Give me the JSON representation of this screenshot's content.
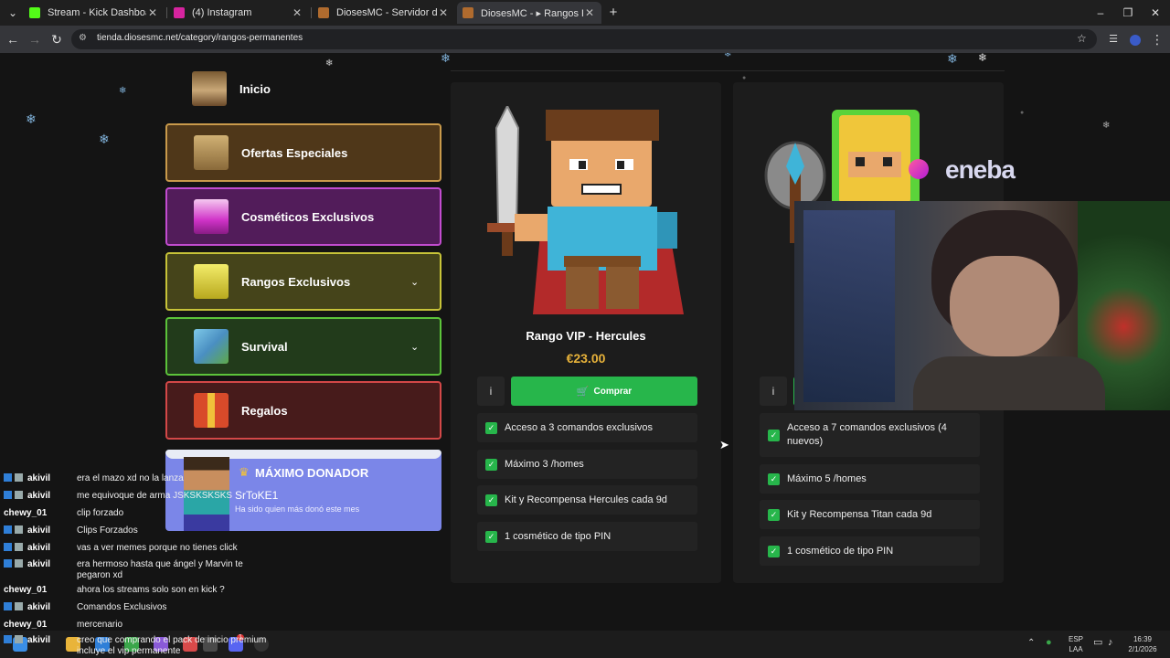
{
  "browser": {
    "tabs": [
      {
        "title": "Stream - Kick Dashboard",
        "color": "#53fc18"
      },
      {
        "title": "(4) Instagram",
        "color": "#d6249f"
      },
      {
        "title": "DiosesMC - Servidor de Minecra",
        "color": "#b06b2e"
      },
      {
        "title": "DiosesMC - ▸ Rangos Permanen",
        "color": "#b06b2e"
      }
    ],
    "url": "tienda.diosesmc.net/category/rangos-permanentes"
  },
  "sidebar": {
    "home_label": "Inicio",
    "items": [
      {
        "label": "Ofertas Especiales",
        "border": "#c99a4b",
        "bg": "#5a3e1f",
        "icon": "treasure-chest-icon"
      },
      {
        "label": "Cosméticos Exclusivos",
        "border": "#c24ccf",
        "bg": "#5a1f63",
        "icon": "cosmetic-box-icon"
      },
      {
        "label": "Rangos Exclusivos",
        "border": "#c7c338",
        "bg": "#4a4a1a",
        "icon": "golden-skull-icon",
        "chevron": "⌄"
      },
      {
        "label": "Survival",
        "border": "#5cc33a",
        "bg": "#243f1e",
        "icon": "earth-block-icon",
        "chevron": "⌄"
      },
      {
        "label": "Regalos",
        "border": "#d34848",
        "bg": "#4e1e1e",
        "icon": "gift-icon"
      }
    ],
    "donor": {
      "title": "MÁXIMO DONADOR",
      "name": "SrToKE1",
      "desc": "Ha sido quien más donó este mes"
    }
  },
  "products": [
    {
      "name": "Rango VIP - Hercules",
      "price": "€23.00",
      "info": "i",
      "buy": "Comprar",
      "features": [
        "Acceso a 3 comandos exclusivos",
        "Máximo 3 /homes",
        "Kit y Recompensa Hercules cada 9d",
        "1 cosmético de tipo PIN"
      ]
    },
    {
      "info": "i",
      "features": [
        "Acceso a 7 comandos exclusivos (4 nuevos)",
        "Máximo 5 /homes",
        "Kit y Recompensa Titan cada 9d",
        "1 cosmético de tipo PIN"
      ]
    }
  ],
  "overlay": {
    "sponsor": "eneba"
  },
  "chat": [
    {
      "user": "akivil",
      "badge": true,
      "msg": "era el mazo xd no la lanza"
    },
    {
      "user": "akivil",
      "badge": true,
      "msg": "me equivoque de arma JSKSKSKSKS"
    },
    {
      "user": "chewy_01",
      "badge": false,
      "msg": "clip forzado"
    },
    {
      "user": "akivil",
      "badge": true,
      "msg": "Clips Forzados"
    },
    {
      "user": "akivil",
      "badge": true,
      "msg": "vas a ver memes porque no tienes click"
    },
    {
      "user": "akivil",
      "badge": true,
      "msg": "era hermoso hasta que ángel y Marvin te pegaron xd"
    },
    {
      "user": "chewy_01",
      "badge": false,
      "msg": "ahora los streams solo son en kick ?"
    },
    {
      "user": "akivil",
      "badge": true,
      "msg": "Comandos Exclusivos"
    },
    {
      "user": "chewy_01",
      "badge": false,
      "msg": "mercenario"
    },
    {
      "user": "akivil",
      "badge": true,
      "msg": "creo que comprando el pack de inicio premium incluye el vip permanente"
    }
  ],
  "taskbar": {
    "lang1": "ESP",
    "lang2": "LAA",
    "time": "16:39",
    "date": "2/1/2026",
    "badge": "1"
  }
}
